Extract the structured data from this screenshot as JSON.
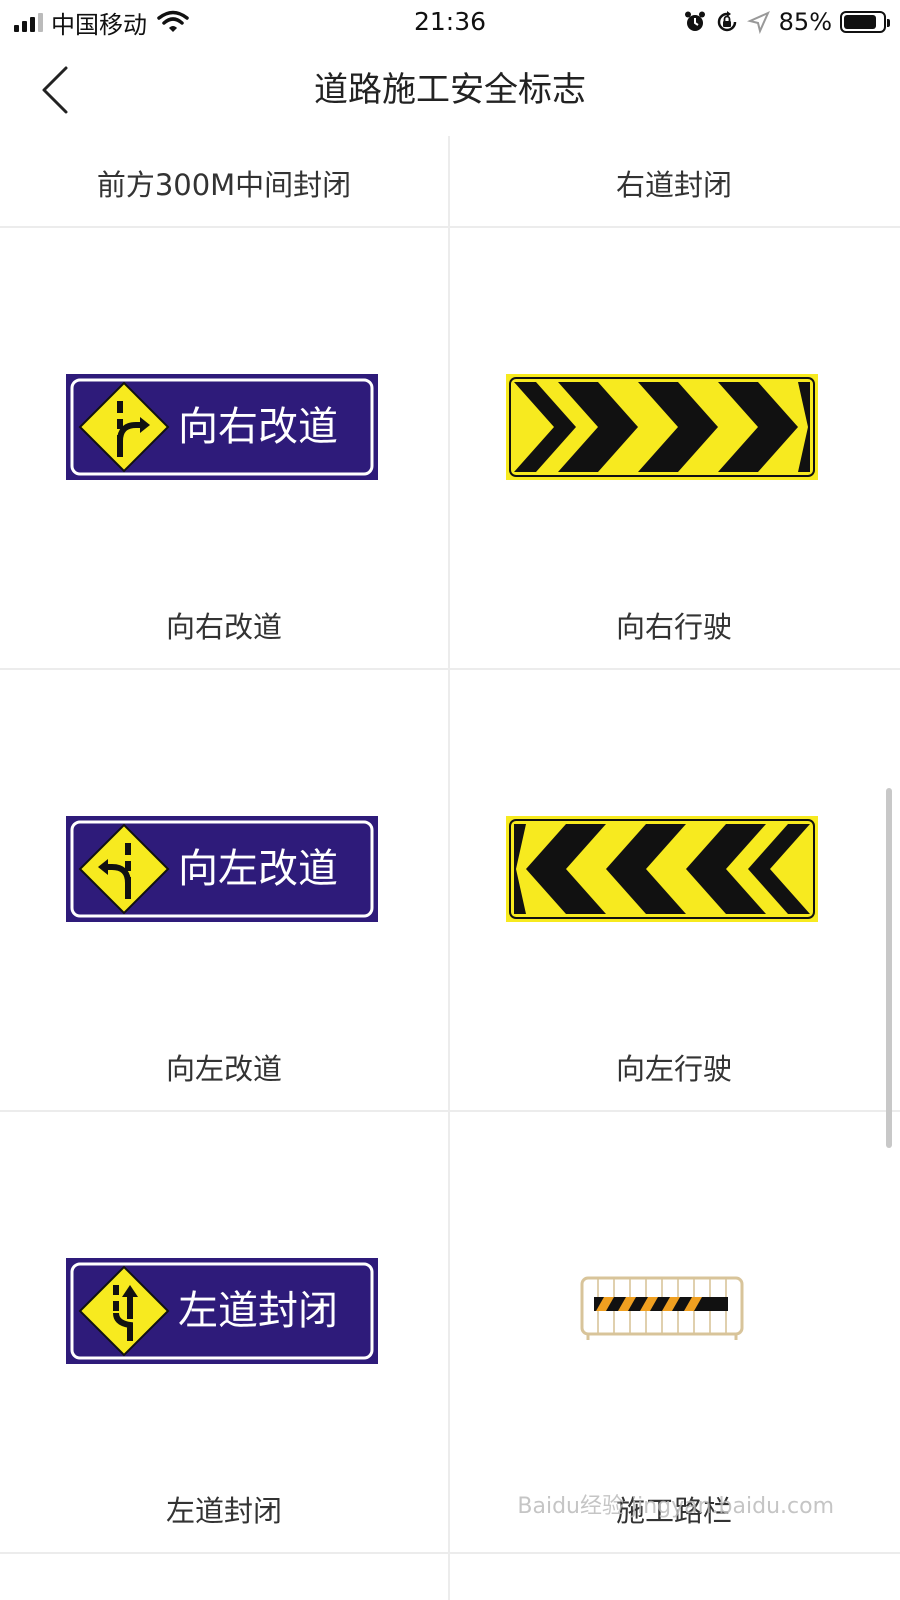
{
  "status_bar": {
    "carrier": "中国移动",
    "time": "21:36",
    "battery_percent": "85%",
    "battery_level": 0.85
  },
  "nav": {
    "title": "道路施工安全标志",
    "back_icon": "chevron-left-icon"
  },
  "items": [
    {
      "label": "前方300M中间封闭"
    },
    {
      "label": "右道封闭"
    },
    {
      "label": "向右改道",
      "sign_text": "向右改道",
      "sign_icon": "detour-right-icon"
    },
    {
      "label": "向右行驶",
      "sign_icon": "chevrons-right-icon"
    },
    {
      "label": "向左改道",
      "sign_text": "向左改道",
      "sign_icon": "detour-left-icon"
    },
    {
      "label": "向左行驶",
      "sign_icon": "chevrons-left-icon"
    },
    {
      "label": "左道封闭",
      "sign_text": "左道封闭",
      "sign_icon": "lane-merge-icon"
    },
    {
      "label": "施工路栏",
      "sign_icon": "barrier-icon"
    }
  ],
  "colors": {
    "sign_blue": "#2e1b7a",
    "sign_yellow": "#f7ea1f",
    "sign_black": "#111111",
    "barrier_orange": "#f0a020"
  },
  "watermark": "Baidu经验 jingyan.baidu.com"
}
